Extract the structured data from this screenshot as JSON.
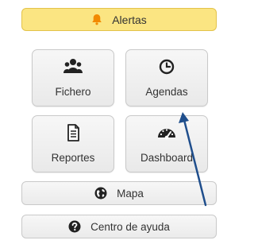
{
  "alert_button": {
    "label": "Alertas",
    "icon": "bell-icon",
    "icon_color": "#f28a00"
  },
  "tiles": {
    "fichero": {
      "label": "Fichero",
      "icon": "users-icon"
    },
    "agendas": {
      "label": "Agendas",
      "icon": "clock-icon"
    },
    "reportes": {
      "label": "Reportes",
      "icon": "document-icon"
    },
    "dashboard": {
      "label": "Dashboard",
      "icon": "speedometer-icon"
    }
  },
  "buttons": {
    "mapa": {
      "label": "Mapa",
      "icon": "globe-icon"
    },
    "ayuda": {
      "label": "Centro de ayuda",
      "icon": "question-circle-icon"
    }
  },
  "annotation": {
    "icon": "arrow-pointer-icon",
    "color": "#1f4e8c"
  }
}
